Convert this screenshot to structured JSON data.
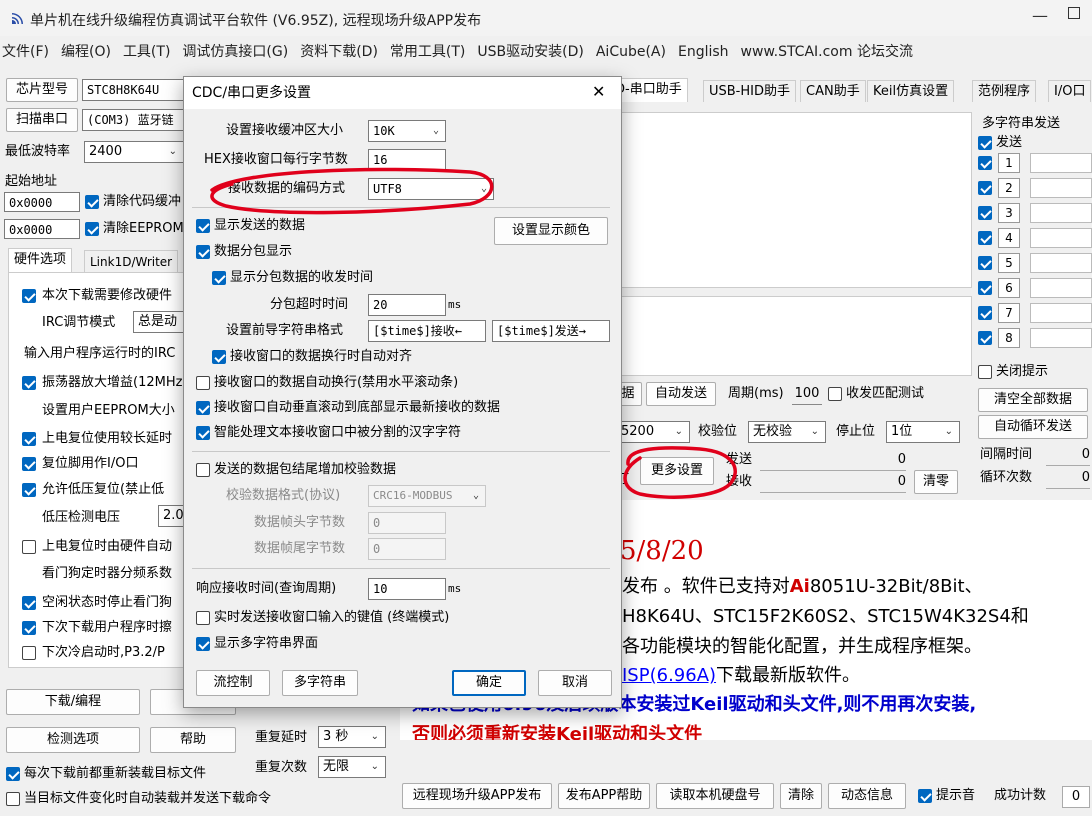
{
  "window": {
    "title": "单片机在线升级编程仿真调试平台软件 (V6.95Z), 远程现场升级APP发布",
    "min": "—"
  },
  "menu": [
    "文件(F)",
    "编程(O)",
    "工具(T)",
    "调试仿真接口(G)",
    "资料下载(D)",
    "常用工具(T)",
    "USB驱动安装(D)",
    "AiCube(A)",
    "English",
    "www.STCAI.com 论坛交流"
  ],
  "left": {
    "chip_label": "芯片型号",
    "chip_value": "STC8H8K64U",
    "scan_label": "扫描串口",
    "port_value": "(COM3) 蓝牙链",
    "baud_label": "最低波特率",
    "baud_value": "2400",
    "start_label": "起始地址",
    "addr1": "0x0000",
    "clear_code": "清除代码缓冲",
    "addr2": "0x0000",
    "clear_eeprom": "清除EEPROM缓",
    "tabs": [
      "硬件选项",
      "Link1D/Writer"
    ],
    "options": [
      {
        "text": "本次下载需要修改硬件",
        "checked": true
      },
      {
        "text": "IRC调节模式",
        "checked": null
      },
      {
        "text": "输入用户程序运行时的IRC",
        "checked": null
      },
      {
        "text": "振荡器放大增益(12MHz",
        "checked": true
      },
      {
        "text": "设置用户EEPROM大小",
        "checked": null
      },
      {
        "text": "上电复位使用较长延时",
        "checked": true
      },
      {
        "text": "复位脚用作I/O口",
        "checked": true
      },
      {
        "text": "允许低压复位(禁止低",
        "checked": true
      },
      {
        "text": "低压检测电压",
        "checked": null
      },
      {
        "text": "上电复位时由硬件自动",
        "checked": false
      },
      {
        "text": "看门狗定时器分频系数",
        "checked": null
      },
      {
        "text": "空闲状态时停止看门狗",
        "checked": true
      },
      {
        "text": "下次下载用户程序时擦",
        "checked": true
      },
      {
        "text": "下次冷启动时,P3.2/P",
        "checked": false
      }
    ],
    "irc_mode_value": "总是动",
    "lvd_value": "2.0",
    "download_btn": "下载/编程",
    "stop_btn": "停",
    "detect_btn": "检测选项",
    "help_btn": "帮助",
    "delay_label": "重复延时",
    "delay_value": "3 秒",
    "count_label": "重复次数",
    "count_value": "无限",
    "reload_each": "每次下载前都重新装载目标文件",
    "reload_change": "当目标文件变化时自动装载并发送下载命令"
  },
  "right": {
    "tabs": [
      "D-串口助手",
      "USB-HID助手",
      "CAN助手",
      "Keil仿真设置",
      "范例程序",
      "I/O口"
    ],
    "multi_title": "多字符串发送",
    "send_col": "发送",
    "rows": [
      "1",
      "2",
      "3",
      "4",
      "5",
      "6",
      "7",
      "8"
    ],
    "close_tip": "关闭提示",
    "clear_all": "清空全部数据",
    "auto_loop": "自动循环发送",
    "interval_label": "间隔时间",
    "interval_value": "0",
    "loop_label": "循环次数",
    "loop_value": "0",
    "data_btn": "据",
    "auto_send": "自动发送",
    "period_label": "周期(ms)",
    "period_value": "100",
    "match_test": "收发匹配测试",
    "baud_value": "5200",
    "parity_label": "校验位",
    "parity_value": "无校验",
    "stop_label": "停止位",
    "stop_value": "1位",
    "more_settings": "更多设置",
    "send_label": "发送",
    "send_count": "0",
    "recv_label": "接收",
    "recv_count": "0",
    "clear_btn": "清零",
    "status": "打"
  },
  "news": {
    "date": "5/8/20",
    "l1": "发布 。软件已支持对",
    "l1_ai": "Ai",
    "l1_rest": "8051U-32Bit/8Bit、",
    "l2": "H8K64U、STC15F2K60S2、STC15W4K32S4和",
    "l3": "各功能模块的智能化配置，并生成程序框架。",
    "l4_link": "ISP(6.96A)",
    "l4": "下载最新版软件。",
    "l5": "如果已使用6.96及后续版本安装过Keil驱动和头文件,则不用再次安装,",
    "l6": "否则必须重新安装Keil驱动和头文件"
  },
  "bottom": {
    "remote": "远程现场升级APP发布",
    "app_help": "发布APP帮助",
    "read_disk": "读取本机硬盘号",
    "clear": "清除",
    "dynamic": "动态信息",
    "beep": "提示音",
    "success_label": "成功计数",
    "success_value": "0"
  },
  "dialog": {
    "title": "CDC/串口更多设置",
    "close": "✕",
    "buf_label": "设置接收缓冲区大小",
    "buf_value": "10K",
    "hex_label": "HEX接收窗口每行字节数",
    "hex_value": "16",
    "enc_label": "接收数据的编码方式",
    "enc_value": "UTF8",
    "show_sent": "显示发送的数据",
    "color_btn": "设置显示颜色",
    "packet_show": "数据分包显示",
    "packet_time": "显示分包数据的收发时间",
    "timeout_label": "分包超时时间",
    "timeout_value": "20",
    "ms": "ms",
    "prefix_label": "设置前导字符串格式",
    "prefix_rx": "[$time$]接收←",
    "prefix_tx": "[$time$]发送→",
    "auto_align": "接收窗口的数据换行时自动对齐",
    "auto_wrap": "接收窗口的数据自动换行(禁用水平滚动条)",
    "auto_scroll": "接收窗口自动垂直滚动到底部显示最新接收的数据",
    "smart_split": "智能处理文本接收窗口中被分割的汉字字符",
    "checksum": "发送的数据包结尾增加校验数据",
    "check_fmt_label": "校验数据格式(协议)",
    "check_fmt_value": "CRC16-MODBUS",
    "head_label": "数据帧头字节数",
    "head_value": "0",
    "tail_label": "数据帧尾字节数",
    "tail_value": "0",
    "resp_label": "响应接收时间(查询周期)",
    "resp_value": "10",
    "realtime": "实时发送接收窗口输入的键值 (终端模式)",
    "multi_ui": "显示多字符串界面",
    "flow_btn": "流控制",
    "multi_btn": "多字符串",
    "ok_btn": "确定",
    "cancel_btn": "取消"
  },
  "colors": {
    "accent": "#0067c0",
    "annotation": "#e0001b",
    "news_red": "#d00000",
    "link": "#0000ff"
  }
}
